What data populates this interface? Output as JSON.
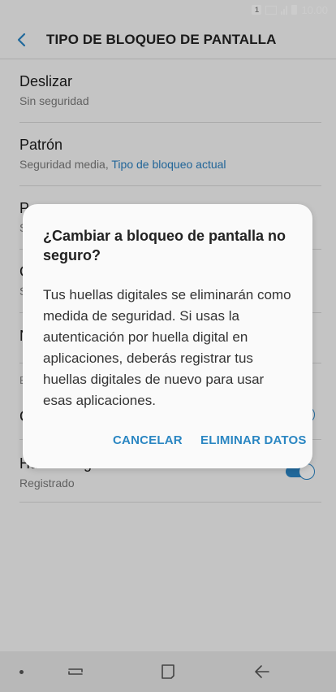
{
  "status_bar": {
    "sim": "1",
    "time": "10.00"
  },
  "header": {
    "title": "TIPO DE BLOQUEO DE PANTALLA"
  },
  "options": [
    {
      "title": "Deslizar",
      "subtitle": "Sin seguridad"
    },
    {
      "title": "Patrón",
      "subtitle": "Seguridad media,",
      "subtitle_accent": "Tipo de bloqueo actual"
    },
    {
      "title": "P",
      "subtitle": "S"
    },
    {
      "title": "C",
      "subtitle": "S"
    },
    {
      "title": "N"
    }
  ],
  "section": {
    "label": "E"
  },
  "row_partial": {
    "title": "C"
  },
  "fingerprints": {
    "title": "Huellas digitales",
    "subtitle": "Registrado",
    "toggle": true
  },
  "dialog": {
    "title": "¿Cambiar a bloqueo de pantalla no seguro?",
    "body": "Tus huellas digitales se eliminarán como medida de seguridad. Si usas la autenticación por huella digital en aplicaciones, deberás registrar tus huellas digitales de nuevo para usar esas aplicaciones.",
    "cancel_label": "CANCELAR",
    "confirm_label": "ELIMINAR DATOS"
  },
  "colors": {
    "accent": "#2a84c4",
    "background": "#f5f5f5",
    "scrim": "rgba(0,0,0,0.2)"
  },
  "icons": {
    "back": "back-arrow-icon",
    "recent": "recent-apps-icon",
    "home": "home-icon",
    "nav_back": "nav-back-icon"
  }
}
